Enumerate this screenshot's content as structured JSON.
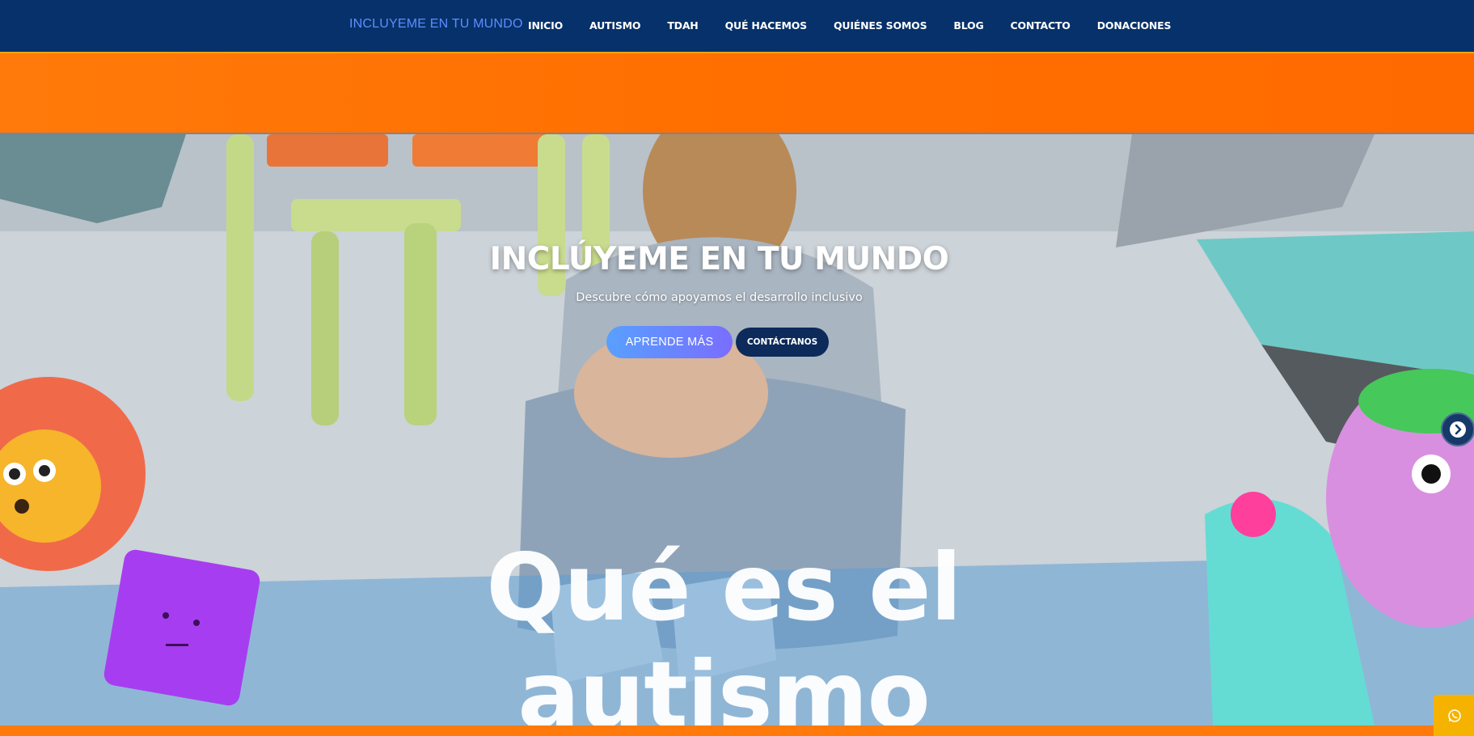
{
  "navbar": {
    "brand": "INCLUYEME EN TU MUNDO",
    "items": [
      "INICIO",
      "AUTISMO",
      "TDAH",
      "QUÉ HACEMOS",
      "QUIÉNES SOMOS",
      "BLOG",
      "CONTACTO",
      "DONACIONES"
    ]
  },
  "hero": {
    "title": "INCLÚYEME EN TU MUNDO",
    "subtitle": "Descubre cómo apoyamos el desarrollo inclusivo",
    "learn_more_label": "APRENDE MÁS",
    "contact_label": "CONTÁCTANOS",
    "caption": "Qué es el autismo"
  },
  "icons": {
    "carousel_next": "chevron-right-circle-icon",
    "floating_chat": "whatsapp-icon"
  },
  "colors": {
    "navbar_bg": "#06316a",
    "brand": "#5f8dff",
    "accent_orange": "#ff6f00",
    "button_gradient_start": "#58a0ff",
    "button_gradient_end": "#7a6dff",
    "contact_button": "#0c2a5a",
    "whatsapp_button": "#f5b300"
  }
}
